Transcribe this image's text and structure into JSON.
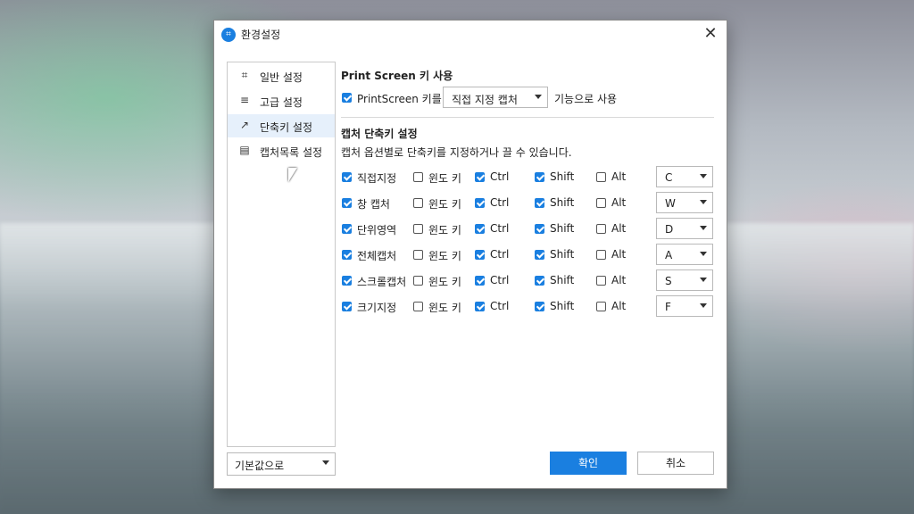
{
  "window": {
    "title": "환경설정",
    "app_icon": "crop-icon"
  },
  "sidebar": {
    "items": [
      {
        "label": "일반 설정",
        "icon": "crop-icon",
        "glyph": "⌗"
      },
      {
        "label": "고급 설정",
        "icon": "sliders-icon",
        "glyph": "≡"
      },
      {
        "label": "단축키 설정",
        "icon": "shortcut-icon",
        "glyph": "↗"
      },
      {
        "label": "캡처목록 설정",
        "icon": "list-icon",
        "glyph": "▤"
      }
    ],
    "active_index": 2
  },
  "defaults_select": {
    "label": "기본값으로"
  },
  "printscreen": {
    "section_title": "Print Screen 키 사용",
    "checkbox_label": "PrintScreen 키를",
    "checked": true,
    "select_value": "직접 지정 캡처",
    "suffix": "기능으로 사용"
  },
  "capture": {
    "section_title": "캡처 단축키 설정",
    "description": "캡처 옵션별로 단축키를 지정하거나 끌 수 있습니다.",
    "modifier_labels": {
      "win": "윈도 키",
      "ctrl": "Ctrl",
      "shift": "Shift",
      "alt": "Alt"
    },
    "rows": [
      {
        "label": "직접지정",
        "enabled": true,
        "win": false,
        "ctrl": true,
        "shift": true,
        "alt": false,
        "key": "C"
      },
      {
        "label": "창 캡처",
        "enabled": true,
        "win": false,
        "ctrl": true,
        "shift": true,
        "alt": false,
        "key": "W"
      },
      {
        "label": "단위영역",
        "enabled": true,
        "win": false,
        "ctrl": true,
        "shift": true,
        "alt": false,
        "key": "D"
      },
      {
        "label": "전체캡처",
        "enabled": true,
        "win": false,
        "ctrl": true,
        "shift": true,
        "alt": false,
        "key": "A"
      },
      {
        "label": "스크롤캡처",
        "enabled": true,
        "win": false,
        "ctrl": true,
        "shift": true,
        "alt": false,
        "key": "S"
      },
      {
        "label": "크기지정",
        "enabled": true,
        "win": false,
        "ctrl": true,
        "shift": true,
        "alt": false,
        "key": "F"
      }
    ]
  },
  "buttons": {
    "ok": "확인",
    "cancel": "취소"
  },
  "colors": {
    "accent": "#1a7fe0"
  }
}
